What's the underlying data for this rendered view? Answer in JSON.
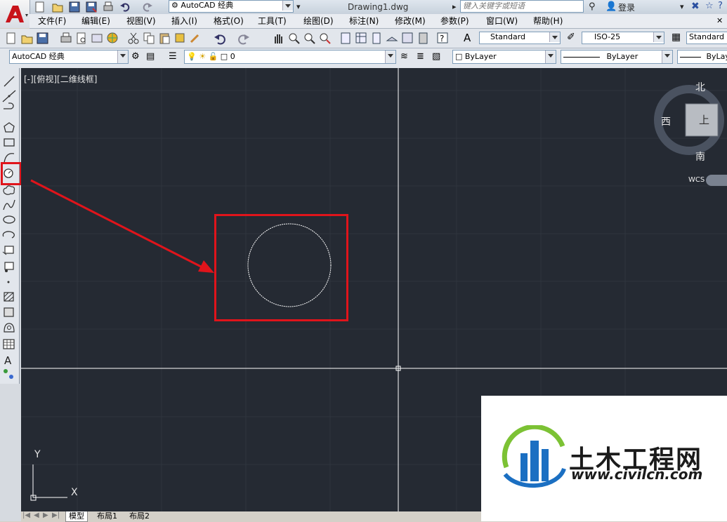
{
  "titlebar": {
    "workspace": "AutoCAD 经典",
    "filename": "Drawing1.dwg",
    "search_placeholder": "键入关键字或短语",
    "login": "登录"
  },
  "menus": [
    "文件(F)",
    "编辑(E)",
    "视图(V)",
    "插入(I)",
    "格式(O)",
    "工具(T)",
    "绘图(D)",
    "标注(N)",
    "修改(M)",
    "参数(P)",
    "窗口(W)",
    "帮助(H)"
  ],
  "styles_toolbar": {
    "text_style": "Standard",
    "dim_style": "ISO-25",
    "table_style": "Standard"
  },
  "layers_toolbar": {
    "workspace": "AutoCAD 经典",
    "layer": "0",
    "color": "ByLayer",
    "linetype": "ByLayer",
    "lineweight": "ByLay"
  },
  "viewport": {
    "label": "[-][俯视][二维线框]"
  },
  "viewcube": {
    "north": "北",
    "south": "南",
    "west": "西",
    "face": "上",
    "wcs": "WCS"
  },
  "ucs": {
    "x": "X",
    "y": "Y"
  },
  "tabs": [
    "模型",
    "布局1",
    "布局2"
  ],
  "watermark": {
    "name": "土木工程网",
    "url": "www.civilcn.com"
  },
  "colors": {
    "canvas": "#252a33",
    "highlight": "#e0141b",
    "crosshair": "#ffffff"
  }
}
